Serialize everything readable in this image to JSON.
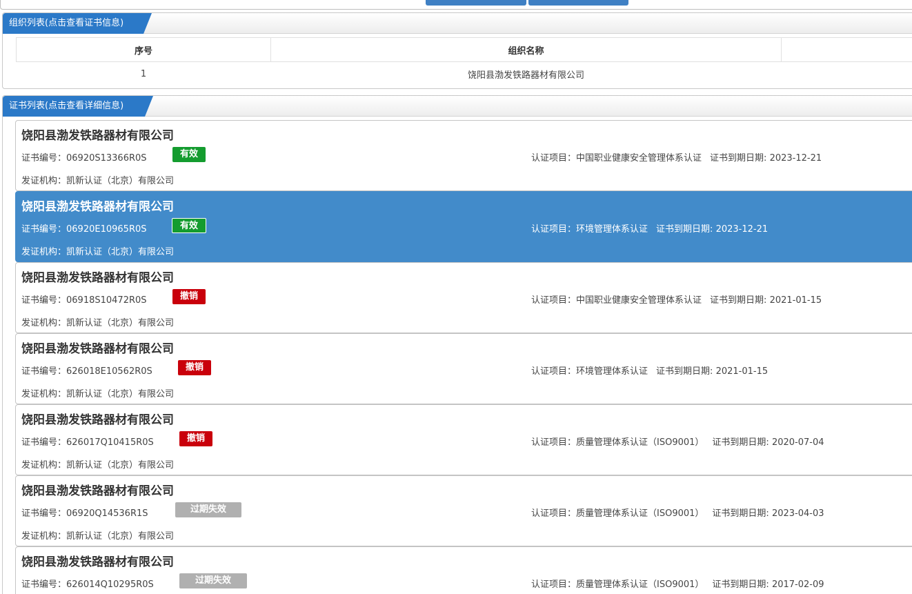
{
  "org_panel": {
    "title": "组织列表(点击查看证书信息)",
    "columns": [
      "序号",
      "组织名称",
      ""
    ],
    "rows": [
      {
        "index": "1",
        "name": "饶阳县渤发铁路器材有限公司"
      }
    ]
  },
  "cert_panel": {
    "title": "证书列表(点击查看详细信息)",
    "labels": {
      "cert_no": "证书编号：",
      "issuer": "发证机构：",
      "project": "认证项目：",
      "expiry": "证书到期日期:"
    },
    "certs": [
      {
        "org": "饶阳县渤发铁路器材有限公司",
        "cert_no_value": "06920S13366R0S",
        "status": "有效",
        "issuer_value": "凯新认证（北京）有限公司",
        "project_value": "中国职业健康安全管理体系认证",
        "expiry_value": "2023-12-21"
      },
      {
        "org": "饶阳县渤发铁路器材有限公司",
        "cert_no_value": "06920E10965R0S",
        "status": "有效",
        "issuer_value": "凯新认证（北京）有限公司",
        "project_value": "环境管理体系认证",
        "expiry_value": "2023-12-21"
      },
      {
        "org": "饶阳县渤发铁路器材有限公司",
        "cert_no_value": "06918S10472R0S",
        "status": "撤销",
        "issuer_value": "凯新认证（北京）有限公司",
        "project_value": "中国职业健康安全管理体系认证",
        "expiry_value": "2021-01-15"
      },
      {
        "org": "饶阳县渤发铁路器材有限公司",
        "cert_no_value": "626018E10562R0S",
        "status": "撤销",
        "issuer_value": "凯新认证（北京）有限公司",
        "project_value": "环境管理体系认证",
        "expiry_value": "2021-01-15"
      },
      {
        "org": "饶阳县渤发铁路器材有限公司",
        "cert_no_value": "626017Q10415R0S",
        "status": "撤销",
        "issuer_value": "凯新认证（北京）有限公司",
        "project_value": "质量管理体系认证（ISO9001）",
        "expiry_value": "2020-07-04"
      },
      {
        "org": "饶阳县渤发铁路器材有限公司",
        "cert_no_value": "06920Q14536R1S",
        "status": "过期失效",
        "issuer_value": "凯新认证（北京）有限公司",
        "project_value": "质量管理体系认证（ISO9001）",
        "expiry_value": "2023-04-03"
      },
      {
        "org": "饶阳县渤发铁路器材有限公司",
        "cert_no_value": "626014Q10295R0S",
        "status": "过期失效",
        "issuer_value": "",
        "project_value": "质量管理体系认证（ISO9001）",
        "expiry_value": "2017-02-09"
      }
    ]
  },
  "colors": {
    "accent": "#2b79c8",
    "selected": "#428bca",
    "valid": "#149c2f",
    "revoked": "#c9000b",
    "expired": "#b0b0b0"
  }
}
